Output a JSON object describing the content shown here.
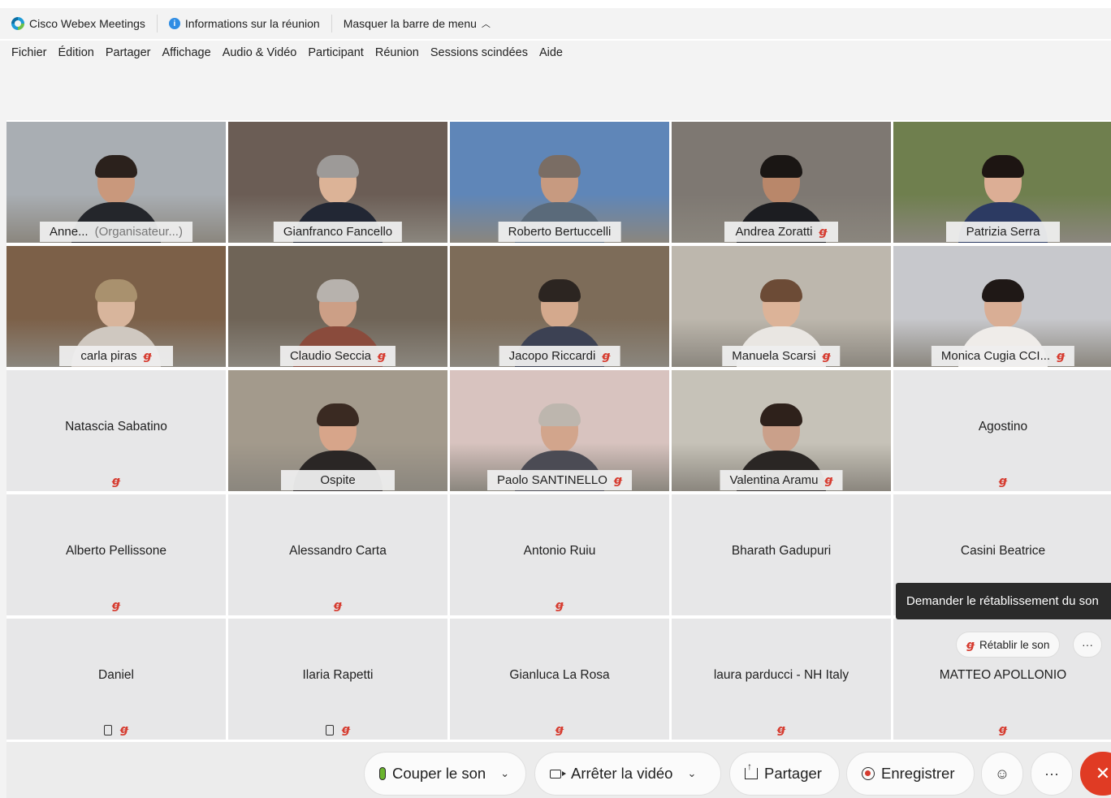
{
  "titlebar": {
    "app_name": "Cisco Webex Meetings",
    "meeting_info": "Informations sur la réunion",
    "hide_menu": "Masquer la barre de menu"
  },
  "menubar": [
    "Fichier",
    "Édition",
    "Partager",
    "Affichage",
    "Audio & Vidéo",
    "Participant",
    "Réunion",
    "Sessions scindées",
    "Aide"
  ],
  "video_tiles": [
    {
      "name": "Anne...",
      "suffix": "(Organisateur...)",
      "muted": false,
      "bg": "#a9aeb3",
      "shirt": "#24262b",
      "skin": "#c9987c",
      "hair": "#2b211c"
    },
    {
      "name": "Gianfranco Fancello",
      "suffix": "",
      "muted": false,
      "bg": "#6b5d55",
      "shirt": "#222734",
      "skin": "#dcb397",
      "hair": "#9d9a98"
    },
    {
      "name": "Roberto Bertuccelli",
      "suffix": "",
      "muted": false,
      "bg": "#5f86b8",
      "shirt": "#5a6a7a",
      "skin": "#c79a80",
      "hair": "#7a6d64"
    },
    {
      "name": "Andrea Zoratti",
      "suffix": "",
      "muted": true,
      "bg": "#7e7872",
      "shirt": "#1c1d21",
      "skin": "#b9876a",
      "hair": "#1a1614"
    },
    {
      "name": "Patrizia Serra",
      "suffix": "",
      "muted": false,
      "bg": "#6f7f4e",
      "shirt": "#2c3a62",
      "skin": "#dcae95",
      "hair": "#1d1512"
    },
    {
      "name": "carla piras",
      "suffix": "",
      "muted": true,
      "bg": "#7c6048",
      "shirt": "#cfc8c0",
      "skin": "#d8b59c",
      "hair": "#a9916e"
    },
    {
      "name": "Claudio Seccia",
      "suffix": "",
      "muted": true,
      "bg": "#6f6457",
      "shirt": "#8a4b3c",
      "skin": "#cc9f86",
      "hair": "#b7b2ad"
    },
    {
      "name": "Jacopo Riccardi",
      "suffix": "",
      "muted": true,
      "bg": "#7d6c59",
      "shirt": "#3c4153",
      "skin": "#d4a98d",
      "hair": "#2c2521"
    },
    {
      "name": "Manuela Scarsi",
      "suffix": "",
      "muted": true,
      "bg": "#bdb7ad",
      "shirt": "#e9e6e2",
      "skin": "#dcb398",
      "hair": "#6c4b36"
    },
    {
      "name": "Monica Cugia CCI...",
      "suffix": "",
      "muted": true,
      "bg": "#c7c8cc",
      "shirt": "#efece9",
      "skin": "#d9ae95",
      "hair": "#1f1816"
    },
    {
      "name": "Ospite",
      "suffix": "",
      "muted": false,
      "bg": "#a39a8c",
      "shirt": "#2a2625",
      "skin": "#d7a58a",
      "hair": "#3a2a22"
    },
    {
      "name": "Paolo SANTINELLO",
      "suffix": "",
      "muted": true,
      "bg": "#d8c3bf",
      "shirt": "#4b4b54",
      "skin": "#d2a58c",
      "hair": "#bdb6ae"
    },
    {
      "name": "Valentina Aramu",
      "suffix": "",
      "muted": true,
      "bg": "#c6c2b8",
      "shirt": "#2a2624",
      "skin": "#caa08a",
      "hair": "#2e211b"
    }
  ],
  "empty_tiles": [
    {
      "name": "Natascia Sabatino",
      "muted": true,
      "phone": false
    },
    {
      "name": "Agostino",
      "muted": true,
      "phone": false
    },
    {
      "name": "Alberto Pellissone",
      "muted": true,
      "phone": false
    },
    {
      "name": "Alessandro Carta",
      "muted": true,
      "phone": false
    },
    {
      "name": "Antonio Ruiu",
      "muted": true,
      "phone": false
    },
    {
      "name": "Bharath Gadupuri",
      "muted": false,
      "phone": false
    },
    {
      "name": "Casini Beatrice",
      "muted": false,
      "phone": false
    },
    {
      "name": "Daniel",
      "muted": true,
      "phone": true
    },
    {
      "name": "Ilaria Rapetti",
      "muted": true,
      "phone": true
    },
    {
      "name": "Gianluca La Rosa",
      "muted": true,
      "phone": false
    },
    {
      "name": "laura parducci - NH Italy",
      "muted": true,
      "phone": false
    },
    {
      "name": "MATTEO APOLLONIO",
      "muted": true,
      "phone": false
    }
  ],
  "tooltip": "Demander le rétablissement du son",
  "unmute_label": "Rétablir le son",
  "controls": {
    "mute": "Couper le son",
    "stop_video": "Arrêter la vidéo",
    "share": "Partager",
    "record": "Enregistrer"
  },
  "glyphs": {
    "mute": "ꞡ",
    "more": "···",
    "end": "✕",
    "reactions": "☺",
    "chevron_down": "⌄",
    "chevron_up": "^"
  }
}
